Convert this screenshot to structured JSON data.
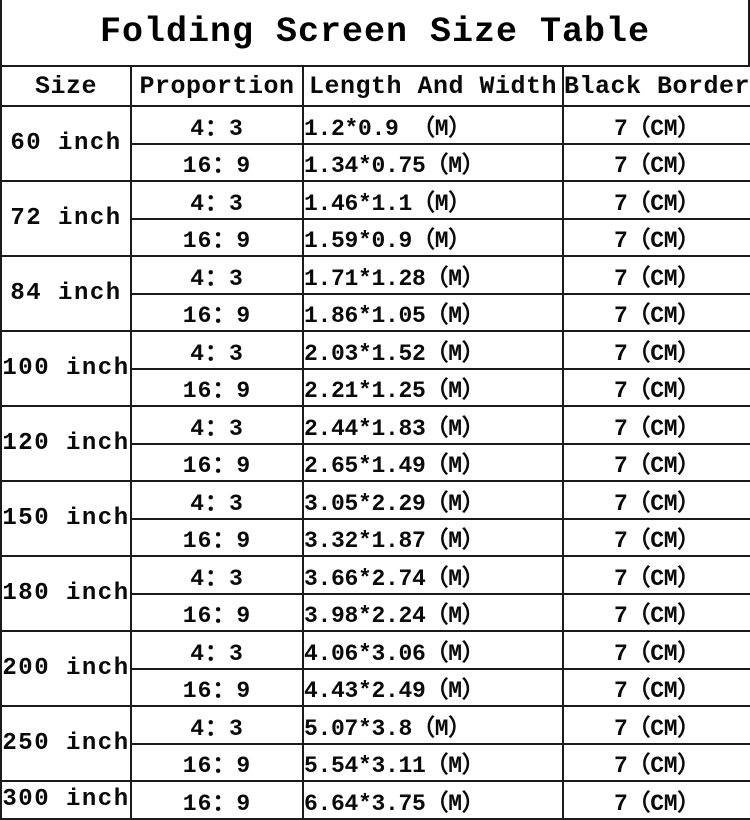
{
  "title": "Folding Screen Size Table",
  "columns": {
    "size": "Size",
    "proportion": "Proportion",
    "length_and_width": "Length And Width",
    "black_border": "Black Border"
  },
  "units": {
    "meter": "（M）",
    "centimeter": "（CM）"
  },
  "rows": [
    {
      "size": "60 inch",
      "entries": [
        {
          "proportion": "4：3",
          "length_and_width": "1.2*0.9 （M）",
          "black_border": "7（CM）"
        },
        {
          "proportion": "16：9",
          "length_and_width": "1.34*0.75（M）",
          "black_border": "7（CM）"
        }
      ]
    },
    {
      "size": "72 inch",
      "entries": [
        {
          "proportion": "4：3",
          "length_and_width": "1.46*1.1（M）",
          "black_border": "7（CM）"
        },
        {
          "proportion": "16：9",
          "length_and_width": "1.59*0.9（M）",
          "black_border": "7（CM）"
        }
      ]
    },
    {
      "size": "84 inch",
      "entries": [
        {
          "proportion": "4：3",
          "length_and_width": "1.71*1.28（M）",
          "black_border": "7（CM）"
        },
        {
          "proportion": "16：9",
          "length_and_width": "1.86*1.05（M）",
          "black_border": "7（CM）"
        }
      ]
    },
    {
      "size": "100 inch",
      "entries": [
        {
          "proportion": "4：3",
          "length_and_width": "2.03*1.52（M）",
          "black_border": "7（CM）"
        },
        {
          "proportion": "16：9",
          "length_and_width": "2.21*1.25（M）",
          "black_border": "7（CM）"
        }
      ]
    },
    {
      "size": "120 inch",
      "entries": [
        {
          "proportion": "4：3",
          "length_and_width": "2.44*1.83（M）",
          "black_border": "7（CM）"
        },
        {
          "proportion": "16：9",
          "length_and_width": "2.65*1.49（M）",
          "black_border": "7（CM）"
        }
      ]
    },
    {
      "size": "150 inch",
      "entries": [
        {
          "proportion": "4：3",
          "length_and_width": "3.05*2.29（M）",
          "black_border": "7（CM）"
        },
        {
          "proportion": "16：9",
          "length_and_width": "3.32*1.87（M）",
          "black_border": "7（CM）"
        }
      ]
    },
    {
      "size": "180 inch",
      "entries": [
        {
          "proportion": "4：3",
          "length_and_width": "3.66*2.74（M）",
          "black_border": "7（CM）"
        },
        {
          "proportion": "16：9",
          "length_and_width": "3.98*2.24（M）",
          "black_border": "7（CM）"
        }
      ]
    },
    {
      "size": "200 inch",
      "entries": [
        {
          "proportion": "4：3",
          "length_and_width": "4.06*3.06（M）",
          "black_border": "7（CM）"
        },
        {
          "proportion": "16：9",
          "length_and_width": "4.43*2.49（M）",
          "black_border": "7（CM）"
        }
      ]
    },
    {
      "size": "250 inch",
      "entries": [
        {
          "proportion": "4：3",
          "length_and_width": "5.07*3.8（M）",
          "black_border": "7（CM）"
        },
        {
          "proportion": "16：9",
          "length_and_width": "5.54*3.11（M）",
          "black_border": "7（CM）"
        }
      ]
    },
    {
      "size": "300 inch",
      "entries": [
        {
          "proportion": "16：9",
          "length_and_width": "6.64*3.75（M）",
          "black_border": "7（CM）"
        }
      ]
    }
  ],
  "colors": {
    "border": "#1b1b1b",
    "text": "#0a0a0a",
    "background": "#ffffff"
  }
}
